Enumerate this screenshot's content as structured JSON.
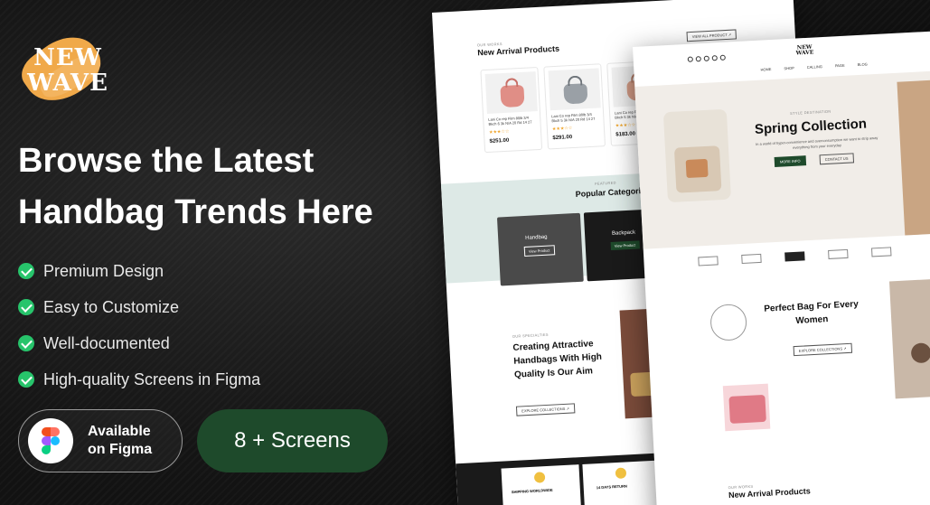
{
  "logo": {
    "line1": "NEW",
    "line2": "WAVE"
  },
  "headline": {
    "line1": "Browse the Latest",
    "line2": "Handbag Trends Here"
  },
  "features": [
    {
      "label": "Premium Design"
    },
    {
      "label": "Easy to Customize"
    },
    {
      "label": "Well-documented"
    },
    {
      "label": "High-quality Screens in Figma"
    }
  ],
  "buttons": {
    "figma_line1": "Available",
    "figma_line2": "on Figma",
    "screens": "8 + Screens"
  },
  "colors": {
    "accent_green": "#1e4a2b",
    "check_green": "#27c46b",
    "logo_orange": "#f0a94a"
  },
  "mock_back": {
    "new_arrival_label": "OUR WORKS",
    "new_arrival_title": "New Arrival Products",
    "view_all": "VIEW ALL PRODUCT ↗",
    "products": [
      {
        "name": "Lani Co rep Film 80lb 3/4 Bkch 6 3k N/A 20 Rd 14 27",
        "stars": "★★★☆☆",
        "price": "$251.00"
      },
      {
        "name": "Lani Co rep Film 80lb 3/4 Bkch 5 3k N/A 20 Rd 14 27",
        "stars": "★★★☆☆",
        "price": "$291.00"
      },
      {
        "name": "Lani Co rep Film 80lb 3/4 Bkch 5 3k N/A 20 Rd 14 27",
        "stars": "★★★☆☆",
        "price": "$183.00"
      }
    ],
    "featured_label": "FEATURED",
    "categories_title": "Popular Categories",
    "cat1": "Handbag",
    "cat1_btn": "View Product",
    "cat2": "Backpack",
    "cat2_btn": "View Product",
    "spec_label": "OUR SPECIALTIES",
    "spec_title1": "Creating Attractive",
    "spec_title2": "Handbags With High",
    "spec_title3": "Quality Is Our Aim",
    "spec_btn": "EXPLORE COLLECTIONS ↗",
    "feature1": "SHIPPING WORLDWIDE",
    "feature2": "14 DAYS RETURN"
  },
  "mock_front": {
    "nav": [
      "HOME",
      "SHOP",
      "CALLING",
      "PAGE",
      "BLOG"
    ],
    "logo_line1": "NEW",
    "logo_line2": "WAVE",
    "hero_label": "STYLE DESTINATION",
    "hero_title": "Spring Collection",
    "hero_text": "In a world of hyper-convenience and overconsumption we want to strip away everything from your everyday",
    "hero_btn1": "MORE INFO",
    "hero_btn2": "CONTACT US",
    "perfect_title1": "Perfect Bag For Every",
    "perfect_title2": "Women",
    "perfect_btn": "EXPLORE COLLECTIONS ↗",
    "new_arrival_label": "OUR WORKS",
    "new_arrival_title": "New Arrival Products"
  }
}
